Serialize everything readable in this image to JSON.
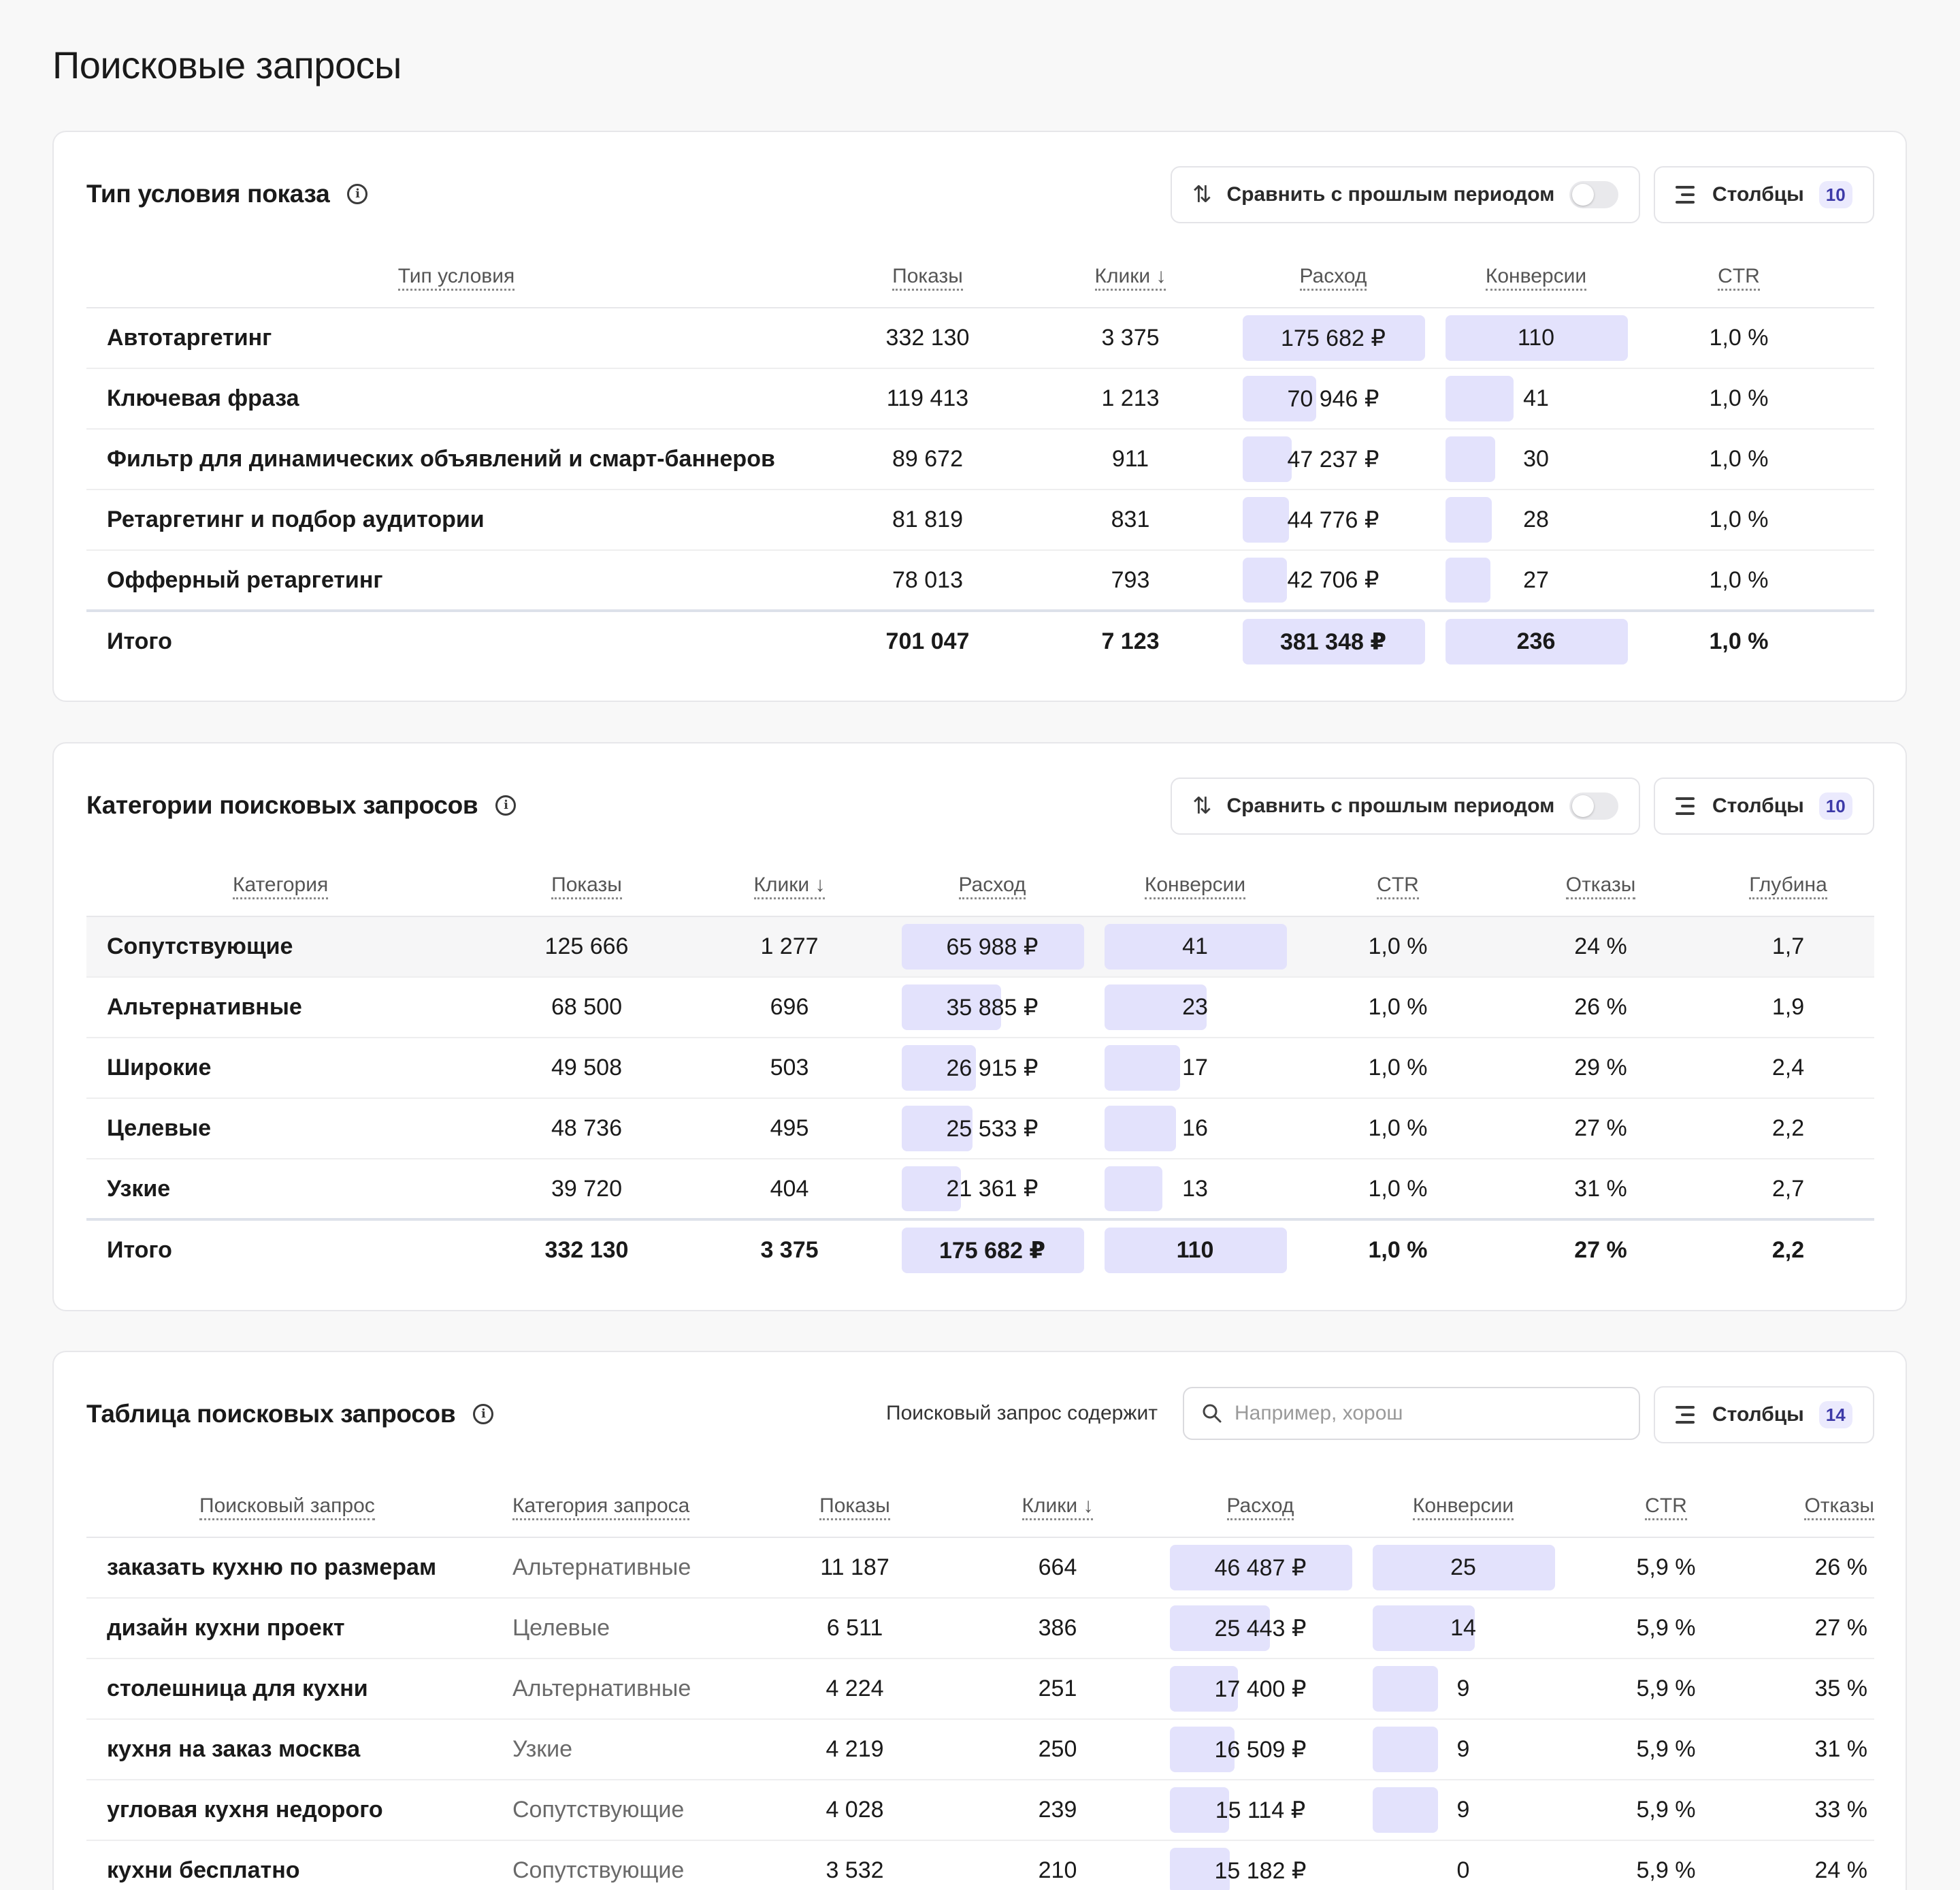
{
  "page": {
    "title": "Поисковые запросы"
  },
  "colors": {
    "bar": "#e3e2fc",
    "badge_bg": "#ebeafd",
    "badge_text": "#3d3aa8"
  },
  "card1": {
    "title": "Тип условия показа",
    "compare_label": "Сравнить с прошлым периодом",
    "columns_label": "Столбцы",
    "columns_count": "10",
    "headers": [
      "Тип условия",
      "Показы",
      "Клики ↓",
      "Расход",
      "Конверсии",
      "CTR"
    ],
    "rows": [
      {
        "name": "Автотаргетинг",
        "shows": "332 130",
        "clicks": "3 375",
        "spend": "175 682 ₽",
        "spend_share": 1.0,
        "conv": "110",
        "conv_share": 1.0,
        "ctr": "1,0 %"
      },
      {
        "name": "Ключевая фраза",
        "shows": "119 413",
        "clicks": "1 213",
        "spend": "70 946 ₽",
        "spend_share": 0.404,
        "conv": "41",
        "conv_share": 0.373,
        "ctr": "1,0 %"
      },
      {
        "name": "Фильтр для динамических объявлений и смарт-баннеров",
        "shows": "89 672",
        "clicks": "911",
        "spend": "47 237 ₽",
        "spend_share": 0.269,
        "conv": "30",
        "conv_share": 0.273,
        "ctr": "1,0 %"
      },
      {
        "name": "Ретаргетинг и подбор аудитории",
        "shows": "81 819",
        "clicks": "831",
        "spend": "44 776 ₽",
        "spend_share": 0.255,
        "conv": "28",
        "conv_share": 0.255,
        "ctr": "1,0 %"
      },
      {
        "name": "Офферный ретаргетинг",
        "shows": "78 013",
        "clicks": "793",
        "spend": "42 706 ₽",
        "spend_share": 0.243,
        "conv": "27",
        "conv_share": 0.245,
        "ctr": "1,0 %"
      }
    ],
    "total": {
      "name": "Итого",
      "shows": "701 047",
      "clicks": "7 123",
      "spend": "381 348 ₽",
      "spend_share": 1.0,
      "conv": "236",
      "conv_share": 1.0,
      "ctr": "1,0 %"
    }
  },
  "card2": {
    "title": "Категории поисковых запросов",
    "compare_label": "Сравнить с прошлым периодом",
    "columns_label": "Столбцы",
    "columns_count": "10",
    "headers": [
      "Категория",
      "Показы",
      "Клики ↓",
      "Расход",
      "Конверсии",
      "CTR",
      "Отказы",
      "Глубина"
    ],
    "rows": [
      {
        "name": "Сопутствующие",
        "shows": "125 666",
        "clicks": "1 277",
        "spend": "65 988 ₽",
        "spend_share": 1.0,
        "conv": "41",
        "conv_share": 1.0,
        "ctr": "1,0 %",
        "bounce": "24 %",
        "depth": "1,7"
      },
      {
        "name": "Альтернативные",
        "shows": "68 500",
        "clicks": "696",
        "spend": "35 885 ₽",
        "spend_share": 0.544,
        "conv": "23",
        "conv_share": 0.561,
        "ctr": "1,0 %",
        "bounce": "26 %",
        "depth": "1,9"
      },
      {
        "name": "Широкие",
        "shows": "49 508",
        "clicks": "503",
        "spend": "26 915 ₽",
        "spend_share": 0.408,
        "conv": "17",
        "conv_share": 0.415,
        "ctr": "1,0 %",
        "bounce": "29 %",
        "depth": "2,4"
      },
      {
        "name": "Целевые",
        "shows": "48 736",
        "clicks": "495",
        "spend": "25 533 ₽",
        "spend_share": 0.387,
        "conv": "16",
        "conv_share": 0.39,
        "ctr": "1,0 %",
        "bounce": "27 %",
        "depth": "2,2"
      },
      {
        "name": "Узкие",
        "shows": "39 720",
        "clicks": "404",
        "spend": "21 361 ₽",
        "spend_share": 0.324,
        "conv": "13",
        "conv_share": 0.317,
        "ctr": "1,0 %",
        "bounce": "31 %",
        "depth": "2,7"
      }
    ],
    "total": {
      "name": "Итого",
      "shows": "332 130",
      "clicks": "3 375",
      "spend": "175 682 ₽",
      "spend_share": 1.0,
      "conv": "110",
      "conv_share": 1.0,
      "ctr": "1,0 %",
      "bounce": "27 %",
      "depth": "2,2"
    }
  },
  "card3": {
    "title": "Таблица поисковых запросов",
    "search_label": "Поисковый запрос содержит",
    "search_placeholder": "Например, хорош",
    "columns_label": "Столбцы",
    "columns_count": "14",
    "headers": [
      "Поисковый запрос",
      "Категория запроса",
      "Показы",
      "Клики ↓",
      "Расход",
      "Конверсии",
      "CTR",
      "Отказы"
    ],
    "rows": [
      {
        "name": "заказать кухню по размерам",
        "cat": "Альтернативные",
        "shows": "11 187",
        "clicks": "664",
        "spend": "46 487 ₽",
        "spend_share": 1.0,
        "conv": "25",
        "conv_share": 1.0,
        "ctr": "5,9 %",
        "bounce": "26 %"
      },
      {
        "name": "дизайн кухни проект",
        "cat": "Целевые",
        "shows": "6 511",
        "clicks": "386",
        "spend": "25 443 ₽",
        "spend_share": 0.547,
        "conv": "14",
        "conv_share": 0.56,
        "ctr": "5,9 %",
        "bounce": "27 %"
      },
      {
        "name": "столешница для кухни",
        "cat": "Альтернативные",
        "shows": "4 224",
        "clicks": "251",
        "spend": "17 400 ₽",
        "spend_share": 0.374,
        "conv": "9",
        "conv_share": 0.36,
        "ctr": "5,9 %",
        "bounce": "35 %"
      },
      {
        "name": "кухня на заказ москва",
        "cat": "Узкие",
        "shows": "4 219",
        "clicks": "250",
        "spend": "16 509 ₽",
        "spend_share": 0.355,
        "conv": "9",
        "conv_share": 0.36,
        "ctr": "5,9 %",
        "bounce": "31 %"
      },
      {
        "name": "угловая кухня недорого",
        "cat": "Сопутствующие",
        "shows": "4 028",
        "clicks": "239",
        "spend": "15 114 ₽",
        "spend_share": 0.325,
        "conv": "9",
        "conv_share": 0.36,
        "ctr": "5,9 %",
        "bounce": "33 %"
      },
      {
        "name": "кухни бесплатно",
        "cat": "Сопутствующие",
        "shows": "3 532",
        "clicks": "210",
        "spend": "15 182 ₽",
        "spend_share": 0.327,
        "conv": "0",
        "conv_share": 0.0,
        "ctr": "5,9 %",
        "bounce": "24 %"
      }
    ]
  }
}
